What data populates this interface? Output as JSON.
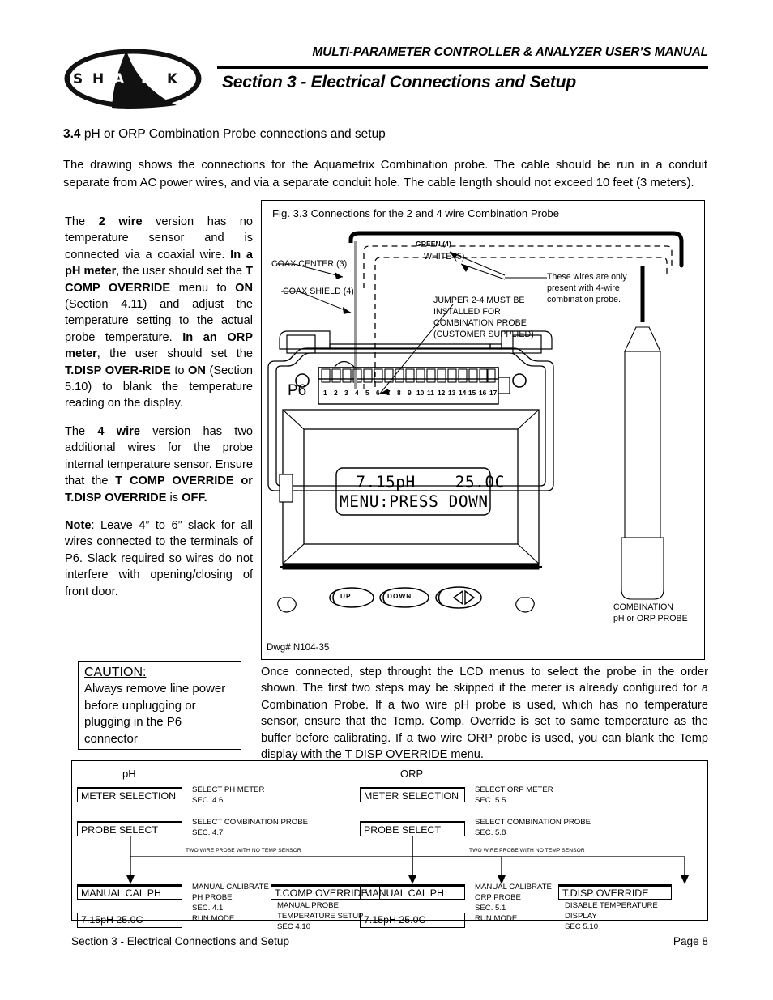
{
  "header": {
    "manual_title": "MULTI-PARAMETER CONTROLLER & ANALYZER USER’S MANUAL",
    "section_title": "Section 3 - Electrical Connections and Setup",
    "logo_text": "SHARK"
  },
  "section": {
    "number": "3.4",
    "heading": "pH or ORP Combination Probe connections and setup",
    "intro": "The drawing shows the connections for the Aquametrix Combination probe. The cable should be run in a conduit separate from AC power wires, and via a separate conduit hole. The cable length should not exceed 10 feet (3 meters)."
  },
  "left_column": {
    "para_2wire": {
      "t1": "The ",
      "b1": "2 wire",
      "t2": " version has no temperature sensor and is connected via a coaxial wire. ",
      "b2": "In a pH meter",
      "t3": ", the user should set the ",
      "b3": "T COMP OVERRIDE",
      "t4": " menu to ",
      "b4": "ON",
      "t5": " (Section 4.11) and adjust the temperature setting to the actual probe temperature. ",
      "b5": "In an ORP meter",
      "t6": ", the user should set the ",
      "b6": "T.DISP OVER-RIDE",
      "t7": " to ",
      "b7": "ON",
      "t8": " (Section 5.10) to blank the temperature reading on the display."
    },
    "para_4wire": {
      "t1": "The ",
      "b1": "4 wire",
      "t2": " version has two additional wires for the probe internal temperature sensor. Ensure that the ",
      "b2": "T COMP OVERRIDE",
      "t3": "   ",
      "b3": "or",
      "t4": "   ",
      "b4": "T.DISP OVERRIDE",
      "t5": " is ",
      "b5": "OFF."
    },
    "para_note": {
      "b1": "Note",
      "t1": ": Leave 4” to 6” slack for all wires connected to the  terminals of P6. Slack required so wires do not interfere with opening/closing of front door."
    },
    "caution": {
      "title": "CAUTION:",
      "body": "Always remove line power before unplugging or plugging in the P6 connector"
    }
  },
  "figure": {
    "caption": "Fig. 3.3 Connections for the 2 and 4 wire Combination Probe",
    "dwg_number": "Dwg# N104-35",
    "labels": {
      "green": "GREEN (4)",
      "white": "WHITE (5)",
      "coax_center": "COAX CENTER (3)",
      "coax_shield": "COAX SHIELD (4)",
      "jumper": [
        "JUMPER 2-4 MUST BE",
        "INSTALLED FOR",
        "COMBINATION PROBE",
        "(CUSTOMER SUPPLIED)"
      ],
      "fourwire_note": [
        "These wires are only",
        "present with 4-wire",
        "combination probe."
      ],
      "probe": [
        "COMBINATION",
        "pH or ORP PROBE"
      ],
      "connector_name": "P6",
      "terminal_numbers": [
        "1",
        "2",
        "3",
        "4",
        "5",
        "6",
        "7",
        "8",
        "9",
        "10",
        "11",
        "12",
        "13",
        "14",
        "15",
        "16",
        "17"
      ]
    },
    "lcd": {
      "line1": " 7.15pH    25.0C",
      "line2": "MENU:PRESS DOWN"
    },
    "buttons": [
      "UP",
      "DOWN"
    ]
  },
  "right_paragraph": "Once connected, step throught the LCD menus to select the probe in the order shown. The first two steps may be skipped if the meter is already configured for a Combination Probe. If a two wire pH probe is used, which has no temperature sensor, ensure that the Temp. Comp. Override is set to same temperature as the buffer before calibrating. If a two wire ORP probe is used, you can blank the Temp display with the T DISP OVERRIDE menu.",
  "flow": {
    "ph": {
      "title": "pH",
      "b1": "METER SELECTION",
      "n1a": "SELECT PH METER",
      "n1b": "SEC. 4.6",
      "b2": "PROBE SELECT",
      "n2a": "SELECT COMBINATION PROBE",
      "n2b": "SEC. 4.7",
      "branch": "TWO WIRE PROBE WITH NO TEMP SENSOR",
      "b3": "MANUAL CAL PH",
      "n3a": "MANUAL CALIBRATE",
      "n3b": "PH PROBE",
      "n3c": "SEC. 4.1",
      "b4": "7.15pH  25.0C",
      "n4": "RUN MODE",
      "b5": "T.COMP OVERRIDE",
      "n5a": "MANUAL PROBE",
      "n5b": "TEMPERATURE SETUP",
      "n5c": "SEC 4.10"
    },
    "orp": {
      "title": "ORP",
      "b1": "METER SELECTION",
      "n1a": "SELECT ORP METER",
      "n1b": "SEC. 5.5",
      "b2": "PROBE SELECT",
      "n2a": "SELECT COMBINATION PROBE",
      "n2b": "SEC. 5.8",
      "branch": "TWO WIRE PROBE WITH NO TEMP SENSOR",
      "b3": "MANUAL CAL PH",
      "n3a": "MANUAL CALIBRATE",
      "n3b": "ORP PROBE",
      "n3c": "SEC. 5.1",
      "b4": "7.15pH  25.0C",
      "n4": "RUN MODE",
      "b5": "T.DISP OVERRIDE",
      "n5a": "DISABLE TEMPERATURE",
      "n5b": "DISPLAY",
      "n5c": "SEC 5.10"
    }
  },
  "footer": {
    "left": "Section 3 - Electrical Connections and Setup",
    "right": "Page 8"
  }
}
